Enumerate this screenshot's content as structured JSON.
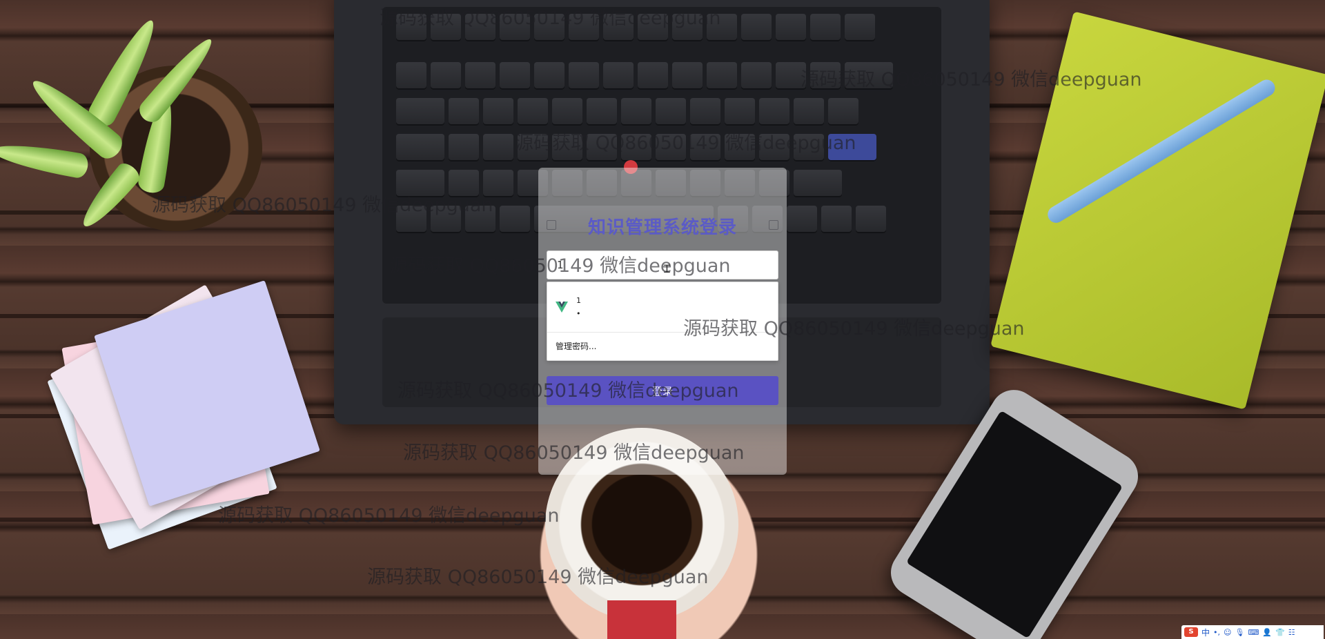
{
  "login": {
    "title": "知识管理系统登录",
    "username_value": "1",
    "button_label": "登录"
  },
  "autofill": {
    "suggestion_username": "1",
    "suggestion_password": "•",
    "manage_passwords_label": "管理密码..."
  },
  "watermark_text": "源码获取 QQ86050149 微信deepguan",
  "ime": {
    "logo": "S",
    "language": "中",
    "glyphs": [
      "•,",
      "☺",
      "🎙",
      "⌨",
      "👤",
      "👕",
      "☷"
    ]
  },
  "colors": {
    "title": "#5b5bc6",
    "button": "#5a52c2",
    "vue_green": "#41b883",
    "vue_dark": "#35495e"
  }
}
